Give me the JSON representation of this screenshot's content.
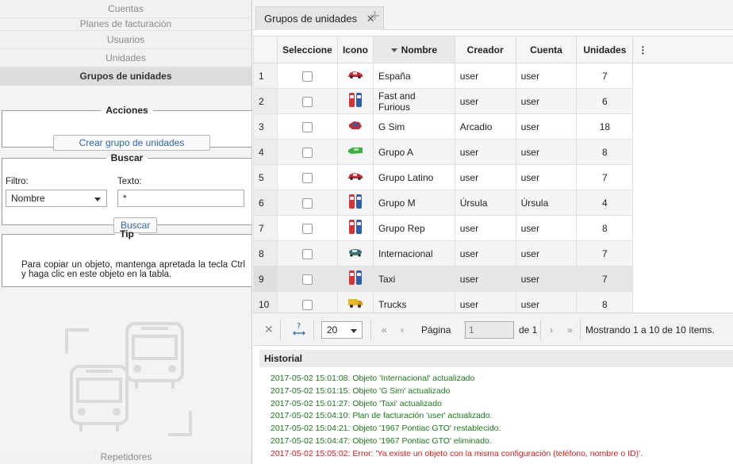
{
  "left_nav": {
    "items": [
      {
        "label": "Cuentas",
        "active": false
      },
      {
        "label": "Planes de facturación",
        "active": false
      },
      {
        "label": "Usuarios",
        "active": false
      },
      {
        "label": "Unidades",
        "active": false
      },
      {
        "label": "Grupos de unidades",
        "active": true
      }
    ],
    "bottom_item": "Repetidores"
  },
  "acciones": {
    "legend": "Acciones",
    "create_button": "Crear grupo de unidades"
  },
  "buscar": {
    "legend": "Buscar",
    "filter_label": "Filtro:",
    "filter_value": "Nombre",
    "text_label": "Texto:",
    "text_value": "*",
    "search_button": "Buscar"
  },
  "tip": {
    "legend": "Tip",
    "text": "Para copiar un objeto, mantenga apretada la tecla Ctrl y haga clic en este objeto en la tabla."
  },
  "tabs": {
    "active_label": "Grupos de unidades",
    "close_glyph": "✕",
    "add_glyph": "+"
  },
  "table": {
    "headers": {
      "select": "Seleccione",
      "icon": "Icono",
      "name": "Nombre",
      "creator": "Creador",
      "account": "Cuenta",
      "units": "Unidades",
      "menu": "⋮"
    },
    "rows": [
      {
        "n": "1",
        "icon": "red-car-icon",
        "name": "España",
        "creator": "user",
        "account": "user",
        "units": "7"
      },
      {
        "n": "2",
        "icon": "twin-cars-icon",
        "name": "Fast and Furious",
        "creator": "user",
        "account": "user",
        "units": "6"
      },
      {
        "n": "3",
        "icon": "sports-car-icon",
        "name": "G Sim",
        "creator": "Arcadio",
        "account": "user",
        "units": "18"
      },
      {
        "n": "4",
        "icon": "green-car-icon",
        "name": "Grupo A",
        "creator": "user",
        "account": "user",
        "units": "8"
      },
      {
        "n": "5",
        "icon": "red-car-icon",
        "name": "Grupo Latino",
        "creator": "user",
        "account": "user",
        "units": "7"
      },
      {
        "n": "6",
        "icon": "twin-cars-icon",
        "name": "Grupo M",
        "creator": "Úrsula",
        "account": "Úrsula",
        "units": "4"
      },
      {
        "n": "7",
        "icon": "twin-cars-icon",
        "name": "Grupo Rep",
        "creator": "user",
        "account": "user",
        "units": "8"
      },
      {
        "n": "8",
        "icon": "tank-car-icon",
        "name": "Internacional",
        "creator": "user",
        "account": "user",
        "units": "7"
      },
      {
        "n": "9",
        "icon": "twin-cars-icon",
        "name": "Taxi",
        "creator": "user",
        "account": "user",
        "units": "7"
      },
      {
        "n": "10",
        "icon": "truck-icon",
        "name": "Trucks",
        "creator": "user",
        "account": "user",
        "units": "8"
      }
    ]
  },
  "pager": {
    "page_size": "20",
    "page_label": "Página",
    "page_value": "1",
    "of_label": "de 1",
    "summary": "Mostrando 1 a 10 de 10 ítems.",
    "help_glyph": "?",
    "first_glyph": "«",
    "prev_glyph": "‹",
    "next_glyph": "›",
    "last_glyph": "»",
    "clear_glyph": "✕"
  },
  "history": {
    "title": "Historial",
    "entries": [
      {
        "text": "2017-05-02 15:01:08: Objeto 'Internacional' actualizado",
        "level": "ok"
      },
      {
        "text": "2017-05-02 15:01:15: Objeto 'G Sim' actualizado",
        "level": "ok"
      },
      {
        "text": "2017-05-02 15:01:27: Objeto 'Taxi' actualizado",
        "level": "ok"
      },
      {
        "text": "2017-05-02 15:04:10: Plan de facturación 'user' actualizado.",
        "level": "ok"
      },
      {
        "text": "2017-05-02 15:04:21: Objeto '1967 Pontiac GTO' restablecido.",
        "level": "ok"
      },
      {
        "text": "2017-05-02 15:04:47: Objeto '1967 Pontiac GTO' eliminado.",
        "level": "ok"
      },
      {
        "text": "2017-05-02 15:05:02: Error: 'Ya existe un objeto con la misma configuración (teléfono, nombre o ID)'.",
        "level": "error"
      }
    ]
  },
  "colors": {
    "ok": "#1a7a1a",
    "error": "#d42020",
    "link_blue": "#2b68a8"
  }
}
